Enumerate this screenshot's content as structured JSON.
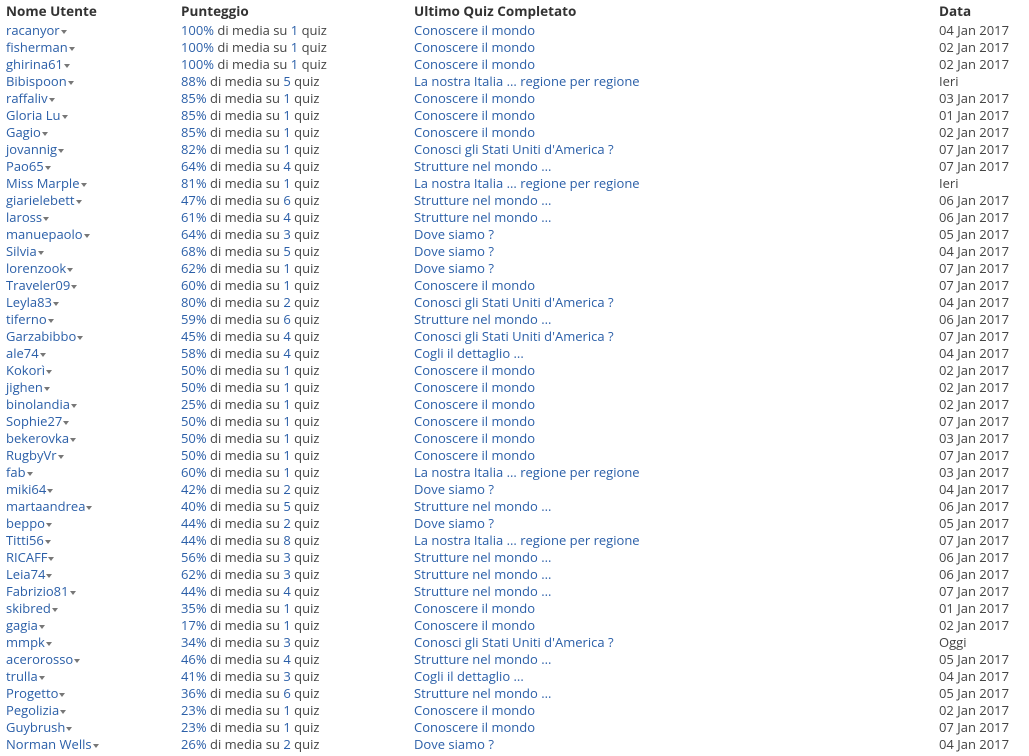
{
  "headers": {
    "user": "Nome Utente",
    "score": "Punteggio",
    "quiz": "Ultimo Quiz Completato",
    "date": "Data"
  },
  "tpl": {
    "media": "di media su",
    "quiz_word": "quiz"
  },
  "rows": [
    {
      "user": "racanyor",
      "pct": "100%",
      "n": "1",
      "quiz": "Conoscere il mondo",
      "date": "04 Jan 2017"
    },
    {
      "user": "fisherman",
      "pct": "100%",
      "n": "1",
      "quiz": "Conoscere il mondo",
      "date": "02 Jan 2017"
    },
    {
      "user": "ghirina61",
      "pct": "100%",
      "n": "1",
      "quiz": "Conoscere il mondo",
      "date": "02 Jan 2017"
    },
    {
      "user": "Bibispoon",
      "pct": "88%",
      "n": "5",
      "quiz": "La nostra Italia ... regione per regione",
      "date": "Ieri"
    },
    {
      "user": "raffaliv",
      "pct": "85%",
      "n": "1",
      "quiz": "Conoscere il mondo",
      "date": "03 Jan 2017"
    },
    {
      "user": "Gloria Lu",
      "pct": "85%",
      "n": "1",
      "quiz": "Conoscere il mondo",
      "date": "01 Jan 2017"
    },
    {
      "user": "Gagio",
      "pct": "85%",
      "n": "1",
      "quiz": "Conoscere il mondo",
      "date": "02 Jan 2017"
    },
    {
      "user": "jovannig",
      "pct": "82%",
      "n": "1",
      "quiz": "Conosci gli Stati Uniti d'America ?",
      "date": "07 Jan 2017"
    },
    {
      "user": "Pao65",
      "pct": "64%",
      "n": "4",
      "quiz": "Strutture nel mondo ...",
      "date": "07 Jan 2017"
    },
    {
      "user": "Miss Marple",
      "pct": "81%",
      "n": "1",
      "quiz": "La nostra Italia ... regione per regione",
      "date": "Ieri"
    },
    {
      "user": "giarielebett",
      "pct": "47%",
      "n": "6",
      "quiz": "Strutture nel mondo ...",
      "date": "06 Jan 2017"
    },
    {
      "user": "laross",
      "pct": "61%",
      "n": "4",
      "quiz": "Strutture nel mondo ...",
      "date": "06 Jan 2017"
    },
    {
      "user": "manuepaolo",
      "pct": "64%",
      "n": "3",
      "quiz": "Dove siamo ?",
      "date": "05 Jan 2017"
    },
    {
      "user": "Silvia",
      "pct": "68%",
      "n": "5",
      "quiz": "Dove siamo ?",
      "date": "04 Jan 2017"
    },
    {
      "user": "lorenzook",
      "pct": "62%",
      "n": "1",
      "quiz": "Dove siamo ?",
      "date": "07 Jan 2017"
    },
    {
      "user": "Traveler09",
      "pct": "60%",
      "n": "1",
      "quiz": "Conoscere il mondo",
      "date": "07 Jan 2017"
    },
    {
      "user": "Leyla83",
      "pct": "80%",
      "n": "2",
      "quiz": "Conosci gli Stati Uniti d'America ?",
      "date": "04 Jan 2017"
    },
    {
      "user": "tiferno",
      "pct": "59%",
      "n": "6",
      "quiz": "Strutture nel mondo ...",
      "date": "06 Jan 2017"
    },
    {
      "user": "Garzabibbo",
      "pct": "45%",
      "n": "4",
      "quiz": "Conosci gli Stati Uniti d'America ?",
      "date": "07 Jan 2017"
    },
    {
      "user": "ale74",
      "pct": "58%",
      "n": "4",
      "quiz": "Cogli il dettaglio ...",
      "date": "04 Jan 2017"
    },
    {
      "user": "Kokorì",
      "pct": "50%",
      "n": "1",
      "quiz": "Conoscere il mondo",
      "date": "02 Jan 2017"
    },
    {
      "user": "jighen",
      "pct": "50%",
      "n": "1",
      "quiz": "Conoscere il mondo",
      "date": "02 Jan 2017"
    },
    {
      "user": "binolandia",
      "pct": "25%",
      "n": "1",
      "quiz": "Conoscere il mondo",
      "date": "02 Jan 2017"
    },
    {
      "user": "Sophie27",
      "pct": "50%",
      "n": "1",
      "quiz": "Conoscere il mondo",
      "date": "07 Jan 2017"
    },
    {
      "user": "bekerovka",
      "pct": "50%",
      "n": "1",
      "quiz": "Conoscere il mondo",
      "date": "03 Jan 2017"
    },
    {
      "user": "RugbyVr",
      "pct": "50%",
      "n": "1",
      "quiz": "Conoscere il mondo",
      "date": "07 Jan 2017"
    },
    {
      "user": "fab",
      "pct": "60%",
      "n": "1",
      "quiz": "La nostra Italia ... regione per regione",
      "date": "03 Jan 2017"
    },
    {
      "user": "miki64",
      "pct": "42%",
      "n": "2",
      "quiz": "Dove siamo ?",
      "date": "04 Jan 2017"
    },
    {
      "user": "martaandrea",
      "pct": "40%",
      "n": "5",
      "quiz": "Strutture nel mondo ...",
      "date": "06 Jan 2017"
    },
    {
      "user": "beppo",
      "pct": "44%",
      "n": "2",
      "quiz": "Dove siamo ?",
      "date": "05 Jan 2017"
    },
    {
      "user": "Titti56",
      "pct": "44%",
      "n": "8",
      "quiz": "La nostra Italia ... regione per regione",
      "date": "07 Jan 2017"
    },
    {
      "user": "RICAFF",
      "pct": "56%",
      "n": "3",
      "quiz": "Strutture nel mondo ...",
      "date": "06 Jan 2017"
    },
    {
      "user": "Leia74",
      "pct": "62%",
      "n": "3",
      "quiz": "Strutture nel mondo ...",
      "date": "06 Jan 2017"
    },
    {
      "user": "Fabrizio81",
      "pct": "44%",
      "n": "4",
      "quiz": "Strutture nel mondo ...",
      "date": "07 Jan 2017"
    },
    {
      "user": "skibred",
      "pct": "35%",
      "n": "1",
      "quiz": "Conoscere il mondo",
      "date": "01 Jan 2017"
    },
    {
      "user": "gagia",
      "pct": "17%",
      "n": "1",
      "quiz": "Conoscere il mondo",
      "date": "02 Jan 2017"
    },
    {
      "user": "mmpk",
      "pct": "34%",
      "n": "3",
      "quiz": "Conosci gli Stati Uniti d'America ?",
      "date": "Oggi"
    },
    {
      "user": "acerorosso",
      "pct": "46%",
      "n": "4",
      "quiz": "Strutture nel mondo ...",
      "date": "05 Jan 2017"
    },
    {
      "user": "trulla",
      "pct": "41%",
      "n": "3",
      "quiz": "Cogli il dettaglio ...",
      "date": "04 Jan 2017"
    },
    {
      "user": "Progetto",
      "pct": "36%",
      "n": "6",
      "quiz": "Strutture nel mondo ...",
      "date": "05 Jan 2017"
    },
    {
      "user": "Pegolizia",
      "pct": "23%",
      "n": "1",
      "quiz": "Conoscere il mondo",
      "date": "02 Jan 2017"
    },
    {
      "user": "Guybrush",
      "pct": "23%",
      "n": "1",
      "quiz": "Conoscere il mondo",
      "date": "07 Jan 2017"
    },
    {
      "user": "Norman Wells",
      "pct": "26%",
      "n": "2",
      "quiz": "Dove siamo ?",
      "date": "04 Jan 2017"
    }
  ]
}
